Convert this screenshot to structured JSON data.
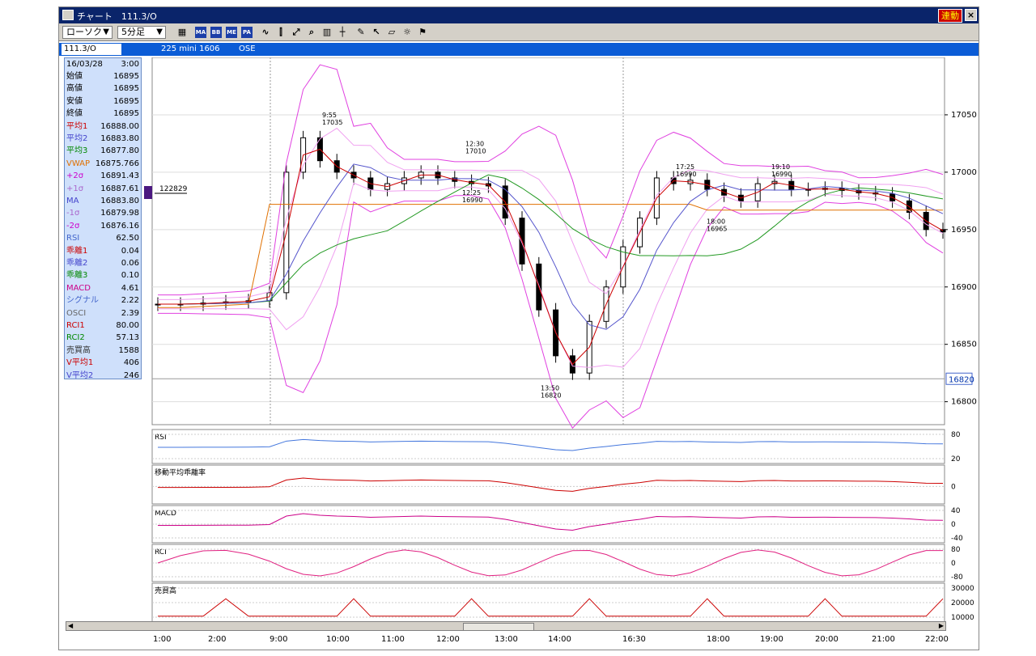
{
  "window": {
    "title": "チャート　111.3/O",
    "link_button": "連動",
    "close_label": "×"
  },
  "toolbar": {
    "chart_type": "ローソク",
    "interval": "5分足",
    "buttons": [
      "chart-icon",
      "MA",
      "BB",
      "ME",
      "PA",
      "line-icon",
      "candle-icon",
      "fit-icon",
      "zoom-icon",
      "bars-icon",
      "crosshair-icon",
      "pen-icon",
      "cursor-icon",
      "eraser-icon",
      "settings-icon",
      "flag-icon"
    ]
  },
  "infobar": {
    "symbol": "111.3/O",
    "name": "225 mini 1606",
    "exchange": "OSE"
  },
  "panel": {
    "date": "16/03/28",
    "time": "3:00",
    "rows": [
      {
        "label": "始値",
        "value": "16895",
        "color": "#000000"
      },
      {
        "label": "高値",
        "value": "16895",
        "color": "#000000"
      },
      {
        "label": "安値",
        "value": "16895",
        "color": "#000000"
      },
      {
        "label": "終値",
        "value": "16895",
        "color": "#000000"
      },
      {
        "label": "平均1",
        "value": "16888.00",
        "color": "#cc0000"
      },
      {
        "label": "平均2",
        "value": "16883.80",
        "color": "#4444cc"
      },
      {
        "label": "平均3",
        "value": "16877.80",
        "color": "#008800"
      },
      {
        "label": "VWAP",
        "value": "16875.766",
        "color": "#e07000"
      },
      {
        "label": "+2σ",
        "value": "16891.43",
        "color": "#cc00cc"
      },
      {
        "label": "+1σ",
        "value": "16887.61",
        "color": "#aa66cc"
      },
      {
        "label": "MA",
        "value": "16883.80",
        "color": "#4444cc"
      },
      {
        "label": "-1σ",
        "value": "16879.98",
        "color": "#aa66cc"
      },
      {
        "label": "-2σ",
        "value": "16876.16",
        "color": "#cc00cc"
      },
      {
        "label": "RSI",
        "value": "62.50",
        "color": "#4466cc"
      },
      {
        "label": "乖離1",
        "value": "0.04",
        "color": "#cc0000"
      },
      {
        "label": "乖離2",
        "value": "0.06",
        "color": "#4444cc"
      },
      {
        "label": "乖離3",
        "value": "0.10",
        "color": "#008800"
      },
      {
        "label": "MACD",
        "value": "4.61",
        "color": "#cc0088"
      },
      {
        "label": "シグナル",
        "value": "2.22",
        "color": "#4466cc"
      },
      {
        "label": "OSCI",
        "value": "2.39",
        "color": "#666666"
      },
      {
        "label": "RCI1",
        "value": "80.00",
        "color": "#cc0000"
      },
      {
        "label": "RCI2",
        "value": "57.13",
        "color": "#008800"
      },
      {
        "label": "売買高",
        "value": "1588",
        "color": "#333333"
      },
      {
        "label": "V平均1",
        "value": "406",
        "color": "#cc0000"
      },
      {
        "label": "V平均2",
        "value": "246",
        "color": "#4444cc"
      }
    ]
  },
  "chart_data": [
    {
      "type": "candlestick",
      "title": "",
      "y_ticks": [
        "17050",
        "17000",
        "16950",
        "16900",
        "16850",
        "16800"
      ],
      "ylim": [
        16780,
        17100
      ],
      "current_price": "16820",
      "volume_marker": "122829",
      "x_ticks": [
        "1:00",
        "2:00",
        "9:00",
        "10:00",
        "11:00",
        "12:00",
        "13:00",
        "14:00",
        "16:30",
        "18:00",
        "19:00",
        "20:00",
        "21:00",
        "22:00"
      ],
      "annotations": [
        {
          "time": "9:55",
          "price": "17035"
        },
        {
          "time": "12:30",
          "price": "17010"
        },
        {
          "time": "12:25",
          "price": "16990"
        },
        {
          "time": "13:50",
          "price": "16820"
        },
        {
          "time": "17:25",
          "price": "16990"
        },
        {
          "time": "18:00",
          "price": "16965"
        },
        {
          "time": "19:10",
          "price": "16990"
        }
      ],
      "close_path": [
        16885,
        16885,
        16886,
        16887,
        16888,
        16895,
        17000,
        17030,
        17010,
        17000,
        16995,
        16985,
        16990,
        16995,
        17000,
        16995,
        16992,
        16990,
        16988,
        16960,
        16920,
        16880,
        16840,
        16825,
        16870,
        16900,
        16935,
        16960,
        16995,
        16990,
        16993,
        16985,
        16980,
        16975,
        16990,
        16992,
        16985,
        16985,
        16986,
        16984,
        16982,
        16981,
        16975,
        16965,
        16950,
        16948
      ]
    },
    {
      "type": "line",
      "title": "RSI",
      "y_ticks": [
        "80",
        "20"
      ],
      "ylim": [
        0,
        100
      ]
    },
    {
      "type": "line",
      "title": "移動平均乖離率",
      "y_ticks": [
        "0"
      ]
    },
    {
      "type": "line",
      "title": "MACD",
      "y_ticks": [
        "40",
        "0",
        "-40"
      ],
      "ylim": [
        -60,
        60
      ]
    },
    {
      "type": "line",
      "title": "RCI",
      "y_ticks": [
        "80",
        "0",
        "-80"
      ],
      "ylim": [
        -100,
        100
      ]
    },
    {
      "type": "bar",
      "title": "売買高",
      "y_ticks": [
        "30000",
        "20000",
        "10000"
      ],
      "ylim": [
        0,
        35000
      ]
    }
  ]
}
